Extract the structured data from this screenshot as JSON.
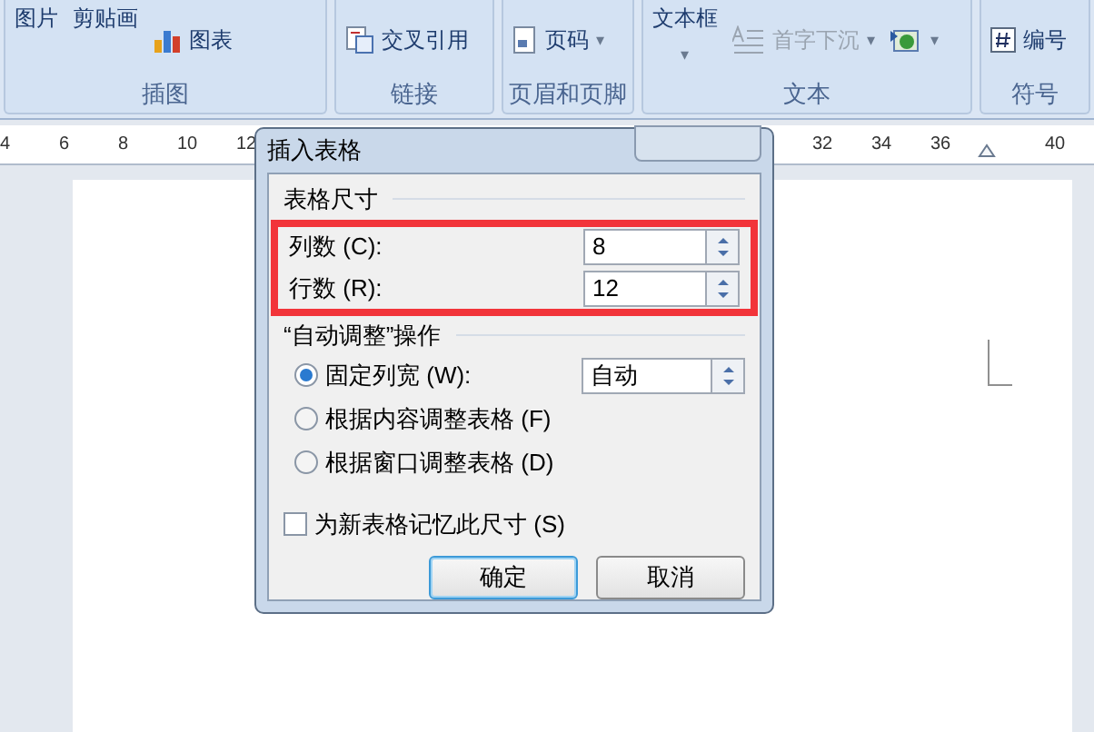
{
  "ribbon": {
    "groups": [
      {
        "label": "插图",
        "items": [
          {
            "kind": "text",
            "label": "图片"
          },
          {
            "kind": "text",
            "label": "剪贴画"
          },
          {
            "kind": "chart",
            "label": "图表"
          }
        ]
      },
      {
        "label": "链接",
        "items": [
          {
            "kind": "link",
            "label": "交叉引用"
          }
        ]
      },
      {
        "label": "页眉和页脚",
        "items": [
          {
            "kind": "page",
            "label": "页码",
            "caret": "▾"
          }
        ]
      },
      {
        "label": "文本",
        "items": [
          {
            "kind": "textbox",
            "label": "文本框",
            "caret": "▾"
          },
          {
            "kind": "dropcap",
            "label": "首字下沉",
            "caret": "▾",
            "disabled": true
          },
          {
            "kind": "picture",
            "caret": "▾"
          }
        ]
      },
      {
        "label": "符号",
        "items": [
          {
            "kind": "number",
            "label": "编号"
          }
        ]
      }
    ]
  },
  "ruler": {
    "left_ticks": [
      "4",
      "6",
      "8",
      "10",
      "12"
    ],
    "right_ticks": [
      "32",
      "34",
      "36",
      "40"
    ]
  },
  "dialog": {
    "title": "插入表格",
    "size_section": "表格尺寸",
    "fields": [
      {
        "label": "列数 (C):",
        "value": "8"
      },
      {
        "label": "行数 (R):",
        "value": "12"
      }
    ],
    "autofit_section": "“自动调整”操作",
    "options": [
      {
        "label": "固定列宽 (W):",
        "selected": true,
        "value": "自动"
      },
      {
        "label": "根据内容调整表格 (F)",
        "selected": false
      },
      {
        "label": "根据窗口调整表格 (D)",
        "selected": false
      }
    ],
    "remember": {
      "label": "为新表格记忆此尺寸 (S)",
      "checked": false
    },
    "buttons": [
      {
        "label": "确定",
        "default": true
      },
      {
        "label": "取消",
        "default": false
      }
    ]
  }
}
